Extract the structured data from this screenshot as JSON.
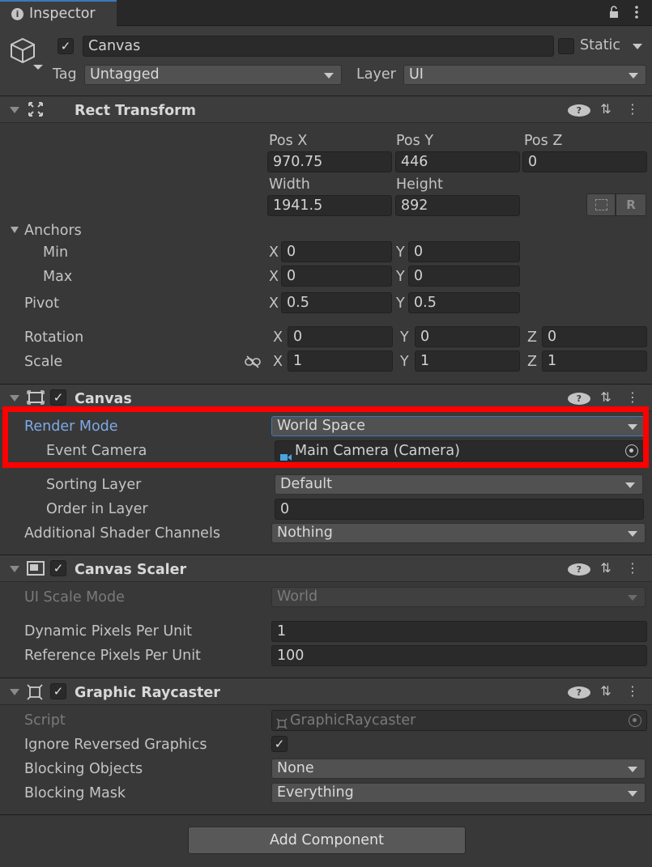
{
  "tab": {
    "title": "Inspector"
  },
  "gameobject": {
    "name": "Canvas",
    "static_label": "Static",
    "tag_label": "Tag",
    "tag_value": "Untagged",
    "layer_label": "Layer",
    "layer_value": "UI"
  },
  "rect_transform": {
    "title": "Rect Transform",
    "pos_x_label": "Pos X",
    "pos_y_label": "Pos Y",
    "pos_z_label": "Pos Z",
    "pos_x": "970.75",
    "pos_y": "446",
    "pos_z": "0",
    "width_label": "Width",
    "height_label": "Height",
    "width": "1941.5",
    "height": "892",
    "r_button": "R",
    "anchors_label": "Anchors",
    "min_label": "Min",
    "min_x": "0",
    "min_y": "0",
    "max_label": "Max",
    "max_x": "0",
    "max_y": "0",
    "pivot_label": "Pivot",
    "pivot_x": "0.5",
    "pivot_y": "0.5",
    "rotation_label": "Rotation",
    "rot_x": "0",
    "rot_y": "0",
    "rot_z": "0",
    "scale_label": "Scale",
    "scale_x": "1",
    "scale_y": "1",
    "scale_z": "1",
    "x": "X",
    "y": "Y",
    "z": "Z"
  },
  "canvas": {
    "title": "Canvas",
    "render_mode_label": "Render Mode",
    "render_mode": "World Space",
    "event_camera_label": "Event Camera",
    "event_camera": "Main Camera (Camera)",
    "sorting_layer_label": "Sorting Layer",
    "sorting_layer": "Default",
    "order_label": "Order in Layer",
    "order": "0",
    "shader_label": "Additional Shader Channels",
    "shader": "Nothing"
  },
  "canvas_scaler": {
    "title": "Canvas Scaler",
    "ui_scale_label": "UI Scale Mode",
    "ui_scale": "World",
    "dynamic_label": "Dynamic Pixels Per Unit",
    "dynamic": "1",
    "reference_label": "Reference Pixels Per Unit",
    "reference": "100"
  },
  "raycaster": {
    "title": "Graphic Raycaster",
    "script_label": "Script",
    "script": "GraphicRaycaster",
    "ignore_label": "Ignore Reversed Graphics",
    "blocking_objects_label": "Blocking Objects",
    "blocking_objects": "None",
    "blocking_mask_label": "Blocking Mask",
    "blocking_mask": "Everything"
  },
  "add_component": "Add Component",
  "colors": {
    "highlight": "#ff0000",
    "selected_label": "#7fa9e6"
  }
}
